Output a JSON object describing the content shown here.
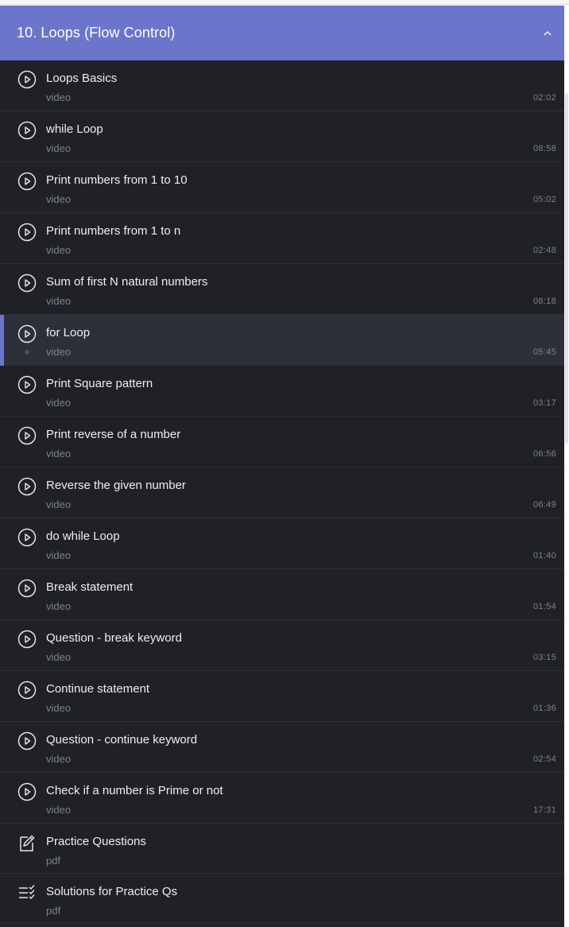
{
  "section": {
    "title": "10. Loops (Flow Control)",
    "collapse_icon": "chevron-up-icon"
  },
  "items": [
    {
      "title": "Loops Basics",
      "type": "video",
      "duration": "02:02",
      "icon": "play-circle-icon"
    },
    {
      "title": "while Loop",
      "type": "video",
      "duration": "08:58",
      "icon": "play-circle-icon"
    },
    {
      "title": "Print numbers from 1 to 10",
      "type": "video",
      "duration": "05:02",
      "icon": "play-circle-icon"
    },
    {
      "title": "Print numbers from 1 to n",
      "type": "video",
      "duration": "02:48",
      "icon": "play-circle-icon"
    },
    {
      "title": "Sum of first N natural numbers",
      "type": "video",
      "duration": "08:18",
      "icon": "play-circle-icon"
    },
    {
      "title": "for Loop",
      "type": "video",
      "duration": "05:45",
      "icon": "play-circle-icon",
      "active": true
    },
    {
      "title": "Print Square pattern",
      "type": "video",
      "duration": "03:17",
      "icon": "play-circle-icon"
    },
    {
      "title": "Print reverse of a number",
      "type": "video",
      "duration": "06:56",
      "icon": "play-circle-icon"
    },
    {
      "title": "Reverse the given number",
      "type": "video",
      "duration": "06:49",
      "icon": "play-circle-icon"
    },
    {
      "title": "do while Loop",
      "type": "video",
      "duration": "01:40",
      "icon": "play-circle-icon"
    },
    {
      "title": "Break statement",
      "type": "video",
      "duration": "01:54",
      "icon": "play-circle-icon"
    },
    {
      "title": "Question - break keyword",
      "type": "video",
      "duration": "03:15",
      "icon": "play-circle-icon"
    },
    {
      "title": "Continue statement",
      "type": "video",
      "duration": "01:36",
      "icon": "play-circle-icon"
    },
    {
      "title": "Question - continue keyword",
      "type": "video",
      "duration": "02:54",
      "icon": "play-circle-icon"
    },
    {
      "title": "Check if a number is Prime or not",
      "type": "video",
      "duration": "17:31",
      "icon": "play-circle-icon"
    },
    {
      "title": "Practice Questions",
      "type": "pdf",
      "duration": "",
      "icon": "edit-document-icon"
    },
    {
      "title": "Solutions for Practice Qs",
      "type": "pdf",
      "duration": "",
      "icon": "checklist-icon"
    }
  ],
  "colors": {
    "accent": "#6b75cc",
    "panel_bg": "#1f2126",
    "active_bg": "#2d3038",
    "text": "#eceef2",
    "muted": "#7d828c"
  }
}
